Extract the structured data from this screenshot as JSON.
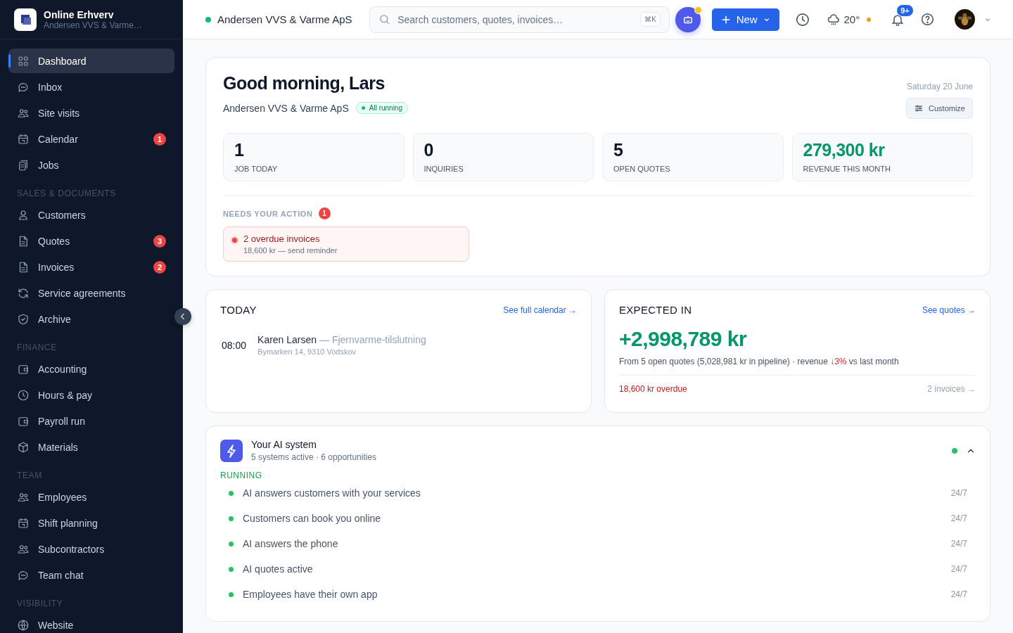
{
  "app": {
    "name": "Online Erhverv",
    "company": "Andersen VVS & Varme…"
  },
  "sidebar": {
    "sections": [
      {
        "items": [
          {
            "label": "Dashboard",
            "selected": true
          },
          {
            "label": "Inbox",
            "selected": false
          },
          {
            "label": "Site visits",
            "selected": false
          },
          {
            "label": "Calendar",
            "selected": false,
            "badge": "1"
          },
          {
            "label": "Jobs",
            "selected": false
          }
        ]
      },
      {
        "heading": "SALES & DOCUMENTS",
        "items": [
          {
            "label": "Customers",
            "selected": false
          },
          {
            "label": "Quotes",
            "selected": false,
            "badge": "3"
          },
          {
            "label": "Invoices",
            "selected": false,
            "badge": "2"
          },
          {
            "label": "Service agreements",
            "selected": false
          },
          {
            "label": "Archive",
            "selected": false
          }
        ]
      },
      {
        "heading": "FINANCE",
        "items": [
          {
            "label": "Accounting",
            "selected": false
          },
          {
            "label": "Hours & pay",
            "selected": false
          },
          {
            "label": "Payroll run",
            "selected": false
          },
          {
            "label": "Materials",
            "selected": false
          }
        ]
      },
      {
        "heading": "TEAM",
        "items": [
          {
            "label": "Employees",
            "selected": false
          },
          {
            "label": "Shift planning",
            "selected": false
          },
          {
            "label": "Subcontractors",
            "selected": false
          },
          {
            "label": "Team chat",
            "selected": false
          }
        ]
      },
      {
        "heading": "VISIBILITY",
        "items": [
          {
            "label": "Website",
            "selected": false
          }
        ]
      }
    ]
  },
  "header": {
    "company": "Andersen VVS & Varme ApS",
    "search": {
      "placeholder": "Search customers, quotes, invoices…",
      "shortcut": "⌘K"
    },
    "assistant_alert": true,
    "new_button": "New",
    "weather": "20°",
    "weather_alert": true,
    "notifications": "9+"
  },
  "overview": {
    "greeting": "Good morning, Lars",
    "date": "Saturday 20 June",
    "company": "Andersen VVS & Varme ApS",
    "status": "All running",
    "customize": "Customize",
    "stats": [
      {
        "value": "1",
        "label": "JOB TODAY",
        "highlight": false
      },
      {
        "value": "0",
        "label": "INQUIRIES",
        "highlight": false
      },
      {
        "value": "5",
        "label": "OPEN QUOTES",
        "highlight": false
      },
      {
        "value": "279,300 kr",
        "label": "REVENUE THIS MONTH",
        "highlight": true
      }
    ],
    "needs_action": {
      "heading": "NEEDS YOUR ACTION",
      "count": "1",
      "items": [
        {
          "title": "2 overdue invoices",
          "detail": "18,600 kr — send reminder"
        }
      ]
    }
  },
  "today": {
    "title": "TODAY",
    "link": "See full calendar →",
    "events": [
      {
        "time": "08:00",
        "name": "Karen Larsen",
        "job": "— Fjernvarme-tilslutning",
        "address": "Bymarken 14, 9310 Vodskov"
      }
    ]
  },
  "expected": {
    "title": "EXPECTED IN",
    "link": "See quotes →",
    "amount": "+2,998,789 kr",
    "summary_start": "From 5 open quotes (5,028,981 kr in pipeline) · revenue ",
    "change": "↓3%",
    "summary_end": " vs last month",
    "overdue": "18,600 kr overdue",
    "invoices_link": "2 invoices →"
  },
  "ai": {
    "title": "Your AI system",
    "subtitle": "5 systems active · 6 opportunities",
    "active": true,
    "expanded": true,
    "section": "RUNNING",
    "items": [
      {
        "label": "AI answers customers with your services",
        "availability": "24/7",
        "active": true
      },
      {
        "label": "Customers can book you online",
        "availability": "24/7",
        "active": true
      },
      {
        "label": "AI answers the phone",
        "availability": "24/7",
        "active": true
      },
      {
        "label": "AI quotes active",
        "availability": "24/7",
        "active": true
      },
      {
        "label": "Employees have their own app",
        "availability": "24/7",
        "active": true
      }
    ]
  }
}
